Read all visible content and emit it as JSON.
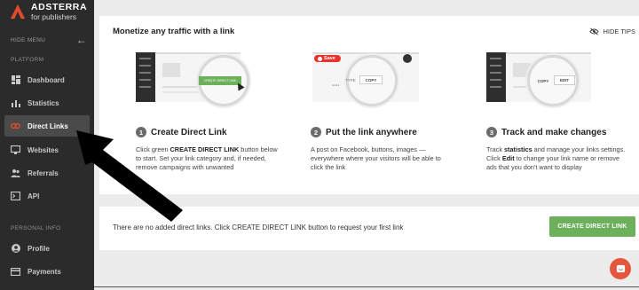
{
  "brand": {
    "name": "ADSTERRA",
    "sub": "for publishers"
  },
  "sidebar": {
    "hide_menu": "HIDE MENU",
    "platform_label": "PLATFORM",
    "items": [
      {
        "label": "Dashboard",
        "icon": "dashboard-icon"
      },
      {
        "label": "Statistics",
        "icon": "statistics-icon"
      },
      {
        "label": "Direct Links",
        "icon": "link-icon",
        "active": true
      },
      {
        "label": "Websites",
        "icon": "monitor-icon"
      },
      {
        "label": "Referrals",
        "icon": "people-icon"
      },
      {
        "label": "API",
        "icon": "terminal-icon"
      }
    ],
    "personal_label": "PERSONAL INFO",
    "personal_items": [
      {
        "label": "Profile",
        "icon": "profile-icon"
      },
      {
        "label": "Payments",
        "icon": "card-icon"
      }
    ]
  },
  "tips": {
    "title": "Monetize any traffic with a link",
    "hide_tips": "HIDE TIPS",
    "steps": [
      {
        "number": "1",
        "title": "Create Direct Link",
        "text_parts": [
          "Click green ",
          "CREATE DIRECT LINK",
          " button below to start. Set your link category and, if needed, remove campaigns with unwanted"
        ]
      },
      {
        "number": "2",
        "title": "Put the link anywhere",
        "text_parts": [
          "A post on Facebook, buttons, images — everywhere where your visitors will be able to click the link"
        ]
      },
      {
        "number": "3",
        "title": "Track and make changes",
        "text_parts": [
          "Track ",
          "statistics",
          " and manage your links settings. Click ",
          "Edit",
          " to change your link name or remove ads that you don't want to display"
        ]
      }
    ],
    "illustration": {
      "create_btn": "CREATE DIRECT LINK",
      "save": "Save",
      "copy": "COPY",
      "edit": "EDIT",
      "type": "TYPE"
    }
  },
  "empty_state": {
    "text": "There are no added direct links. Click CREATE DIRECT LINK button to request your first link",
    "button": "CREATE DIRECT LINK"
  },
  "colors": {
    "accent": "#e24a2d",
    "green": "#6cb05b",
    "sidebar": "#2b2b2b"
  }
}
